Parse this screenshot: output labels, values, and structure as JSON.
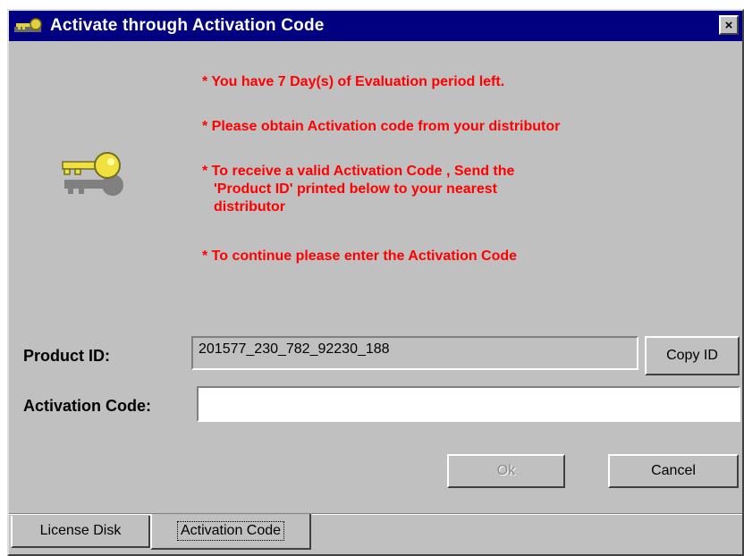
{
  "window": {
    "title": "Activate through Activation Code",
    "close_label": "×"
  },
  "messages": [
    "* You have 7 Day(s) of Evaluation period left.",
    "* Please obtain Activation code from your distributor",
    "* To receive a valid Activation Code , Send the",
    "'Product ID' printed below to your nearest",
    "distributor",
    "* To continue please enter the Activation Code"
  ],
  "form": {
    "product_id_label": "Product ID:",
    "product_id_value": "201577_230_782_92230_188",
    "copy_id_label": "Copy ID",
    "activation_code_label": "Activation Code:",
    "activation_code_value": ""
  },
  "buttons": {
    "ok_label": "Ok",
    "cancel_label": "Cancel"
  },
  "tabs": [
    {
      "label": "License Disk",
      "active": false
    },
    {
      "label": "Activation Code",
      "active": true
    }
  ],
  "colors": {
    "titlebar": "#000080",
    "message_text": "#ff0000",
    "dialog_face": "#c0c0c0"
  }
}
